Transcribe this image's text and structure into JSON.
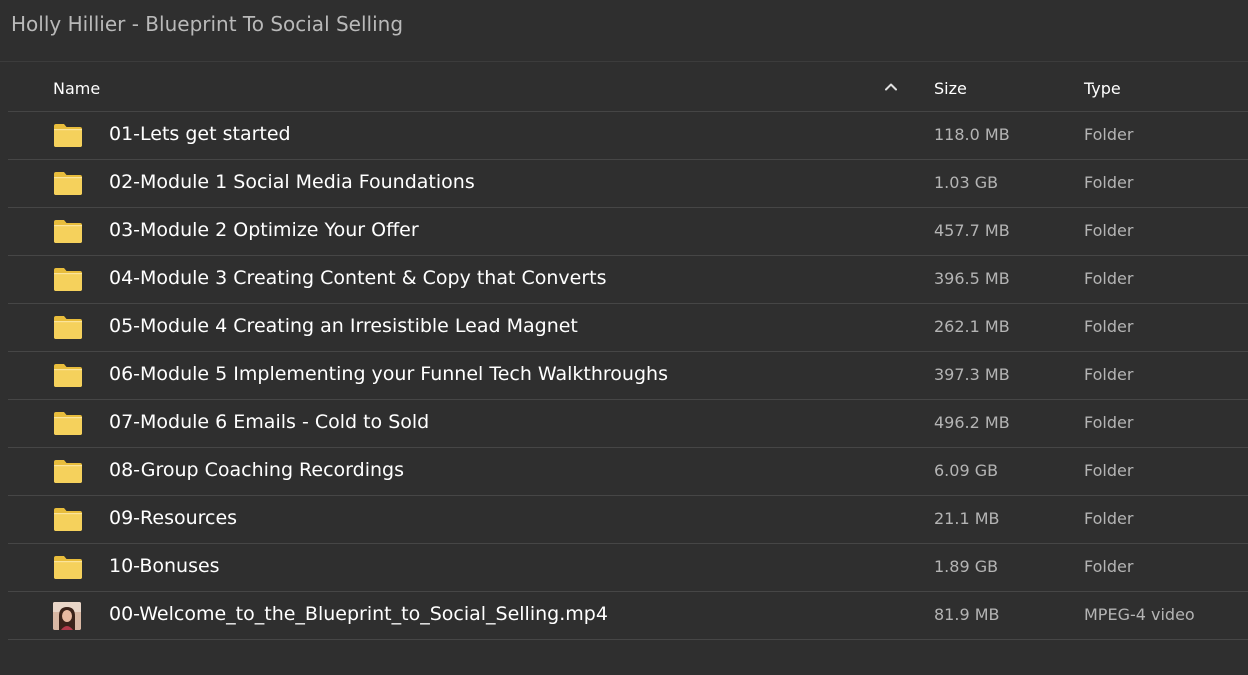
{
  "window": {
    "title": "Holly Hillier - Blueprint To Social Selling"
  },
  "columns": {
    "name": "Name",
    "size": "Size",
    "type": "Type",
    "sort_icon": "chevron-up-icon"
  },
  "colors": {
    "background": "#2f2f2f",
    "folder_yellow": "#f5d15c",
    "folder_yellow_dark": "#e8bd3c",
    "text_primary": "#ffffff",
    "text_secondary": "#b4b4b4",
    "title_text": "#b9b9b9"
  },
  "files": [
    {
      "name": "01-Lets get started",
      "size": "118.0 MB",
      "type": "Folder",
      "icon": "folder-icon"
    },
    {
      "name": "02-Module 1 Social Media Foundations",
      "size": "1.03 GB",
      "type": "Folder",
      "icon": "folder-icon"
    },
    {
      "name": "03-Module 2 Optimize Your Offer",
      "size": "457.7 MB",
      "type": "Folder",
      "icon": "folder-icon"
    },
    {
      "name": "04-Module 3 Creating Content & Copy that Converts",
      "size": "396.5 MB",
      "type": "Folder",
      "icon": "folder-icon"
    },
    {
      "name": "05-Module 4 Creating an Irresistible Lead Magnet",
      "size": "262.1 MB",
      "type": "Folder",
      "icon": "folder-icon"
    },
    {
      "name": "06-Module 5 Implementing your Funnel Tech Walkthroughs",
      "size": "397.3 MB",
      "type": "Folder",
      "icon": "folder-icon"
    },
    {
      "name": "07-Module 6 Emails - Cold to Sold",
      "size": "496.2 MB",
      "type": "Folder",
      "icon": "folder-icon"
    },
    {
      "name": "08-Group Coaching Recordings",
      "size": "6.09 GB",
      "type": "Folder",
      "icon": "folder-icon"
    },
    {
      "name": "09-Resources",
      "size": "21.1 MB",
      "type": "Folder",
      "icon": "folder-icon"
    },
    {
      "name": "10-Bonuses",
      "size": "1.89 GB",
      "type": "Folder",
      "icon": "folder-icon"
    },
    {
      "name": "00-Welcome_to_the_Blueprint_to_Social_Selling.mp4",
      "size": "81.9 MB",
      "type": "MPEG-4 video",
      "icon": "video-thumbnail-icon"
    }
  ]
}
